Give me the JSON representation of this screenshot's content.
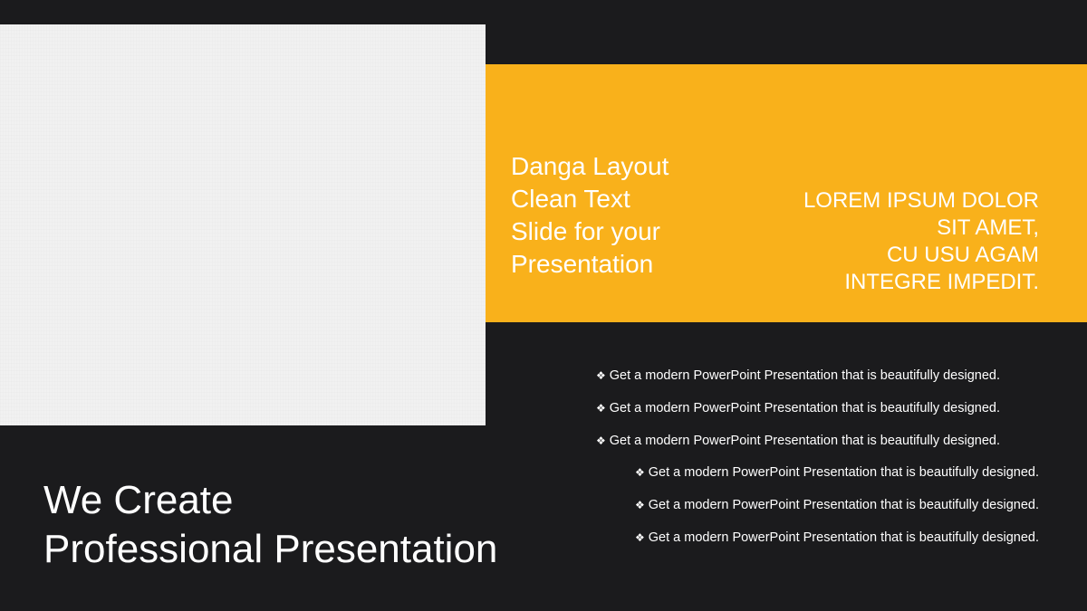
{
  "slide": {
    "background_color": "#1b1b1d",
    "accent_color": "#f9b11b",
    "band_title_lines": [
      "Danga Layout",
      "Clean Text",
      "Slide for your",
      "Presentation"
    ],
    "band_caps_lines": [
      "LOREM IPSUM DOLOR",
      "SIT AMET,",
      "CU USU AGAM",
      "INTEGRE IMPEDIT."
    ],
    "bullet_glyph": "❖",
    "bullets": [
      "Get a modern PowerPoint  Presentation that is beautifully designed.",
      "Get a modern PowerPoint  Presentation that is beautifully designed.",
      "Get a modern PowerPoint  Presentation that is beautifully designed.",
      "Get a modern PowerPoint  Presentation that is beautifully designed.",
      "Get a modern PowerPoint  Presentation that is beautifully designed.",
      "Get a modern PowerPoint  Presentation that is beautifully designed."
    ],
    "headline_lines": [
      "We Create",
      "Professional Presentation"
    ]
  }
}
